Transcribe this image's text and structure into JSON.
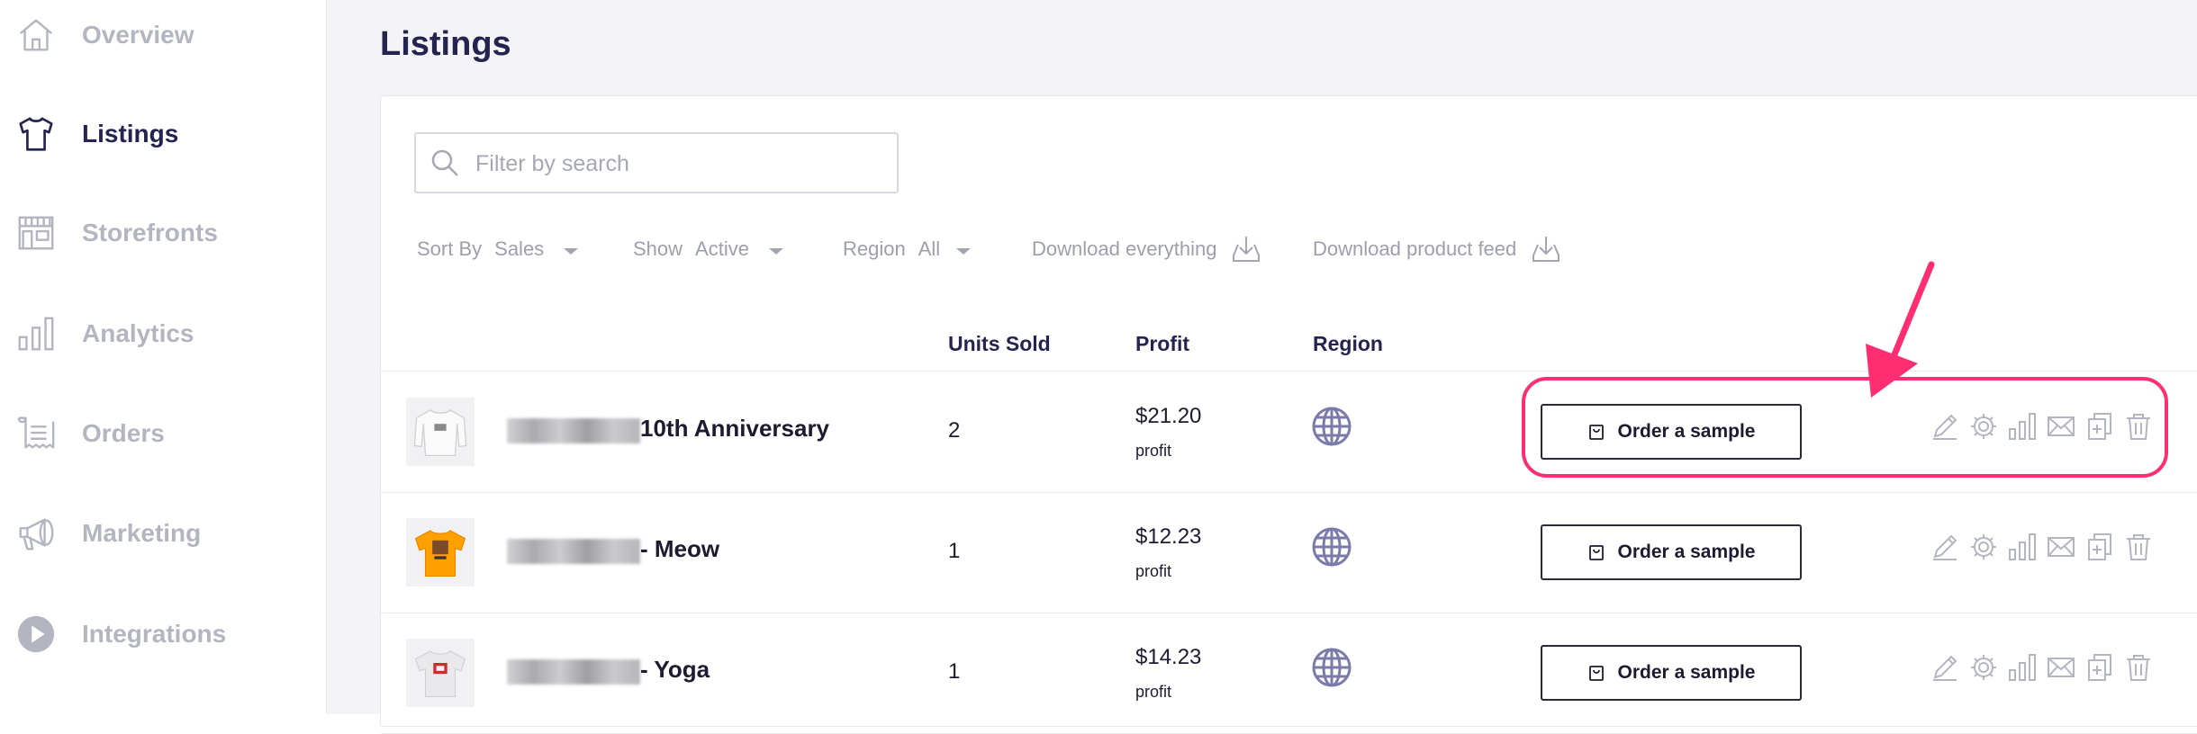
{
  "sidebar": {
    "items": [
      {
        "label": "Overview",
        "icon": "home-icon",
        "active": false
      },
      {
        "label": "Listings",
        "icon": "tshirt-icon",
        "active": true
      },
      {
        "label": "Storefronts",
        "icon": "storefront-icon",
        "active": false
      },
      {
        "label": "Analytics",
        "icon": "bar-chart-icon",
        "active": false
      },
      {
        "label": "Orders",
        "icon": "receipt-icon",
        "active": false
      },
      {
        "label": "Marketing",
        "icon": "megaphone-icon",
        "active": false
      },
      {
        "label": "Integrations",
        "icon": "play-icon",
        "active": false
      }
    ]
  },
  "page": {
    "title": "Listings"
  },
  "search": {
    "placeholder": "Filter by search"
  },
  "filters": {
    "sort_label": "Sort By",
    "sort_value": "Sales",
    "show_label": "Show",
    "show_value": "Active",
    "region_label": "Region",
    "region_value": "All",
    "download_everything": "Download everything",
    "download_feed": "Download product feed"
  },
  "table": {
    "headers": {
      "units": "Units Sold",
      "profit": "Profit",
      "region": "Region"
    },
    "rows": [
      {
        "name": "10th Anniversary",
        "units": "2",
        "price": "$21.20",
        "profit_label": "profit",
        "button": "Order a sample"
      },
      {
        "name": "- Meow",
        "units": "1",
        "price": "$12.23",
        "profit_label": "profit",
        "button": "Order a sample"
      },
      {
        "name": "- Yoga",
        "units": "1",
        "price": "$14.23",
        "profit_label": "profit",
        "button": "Order a sample"
      }
    ]
  },
  "colors": {
    "accent_dark": "#25234f",
    "muted_text": "#b3b5c0",
    "annotation_pink": "#ff2e73",
    "globe_purple": "#7b7bab"
  }
}
